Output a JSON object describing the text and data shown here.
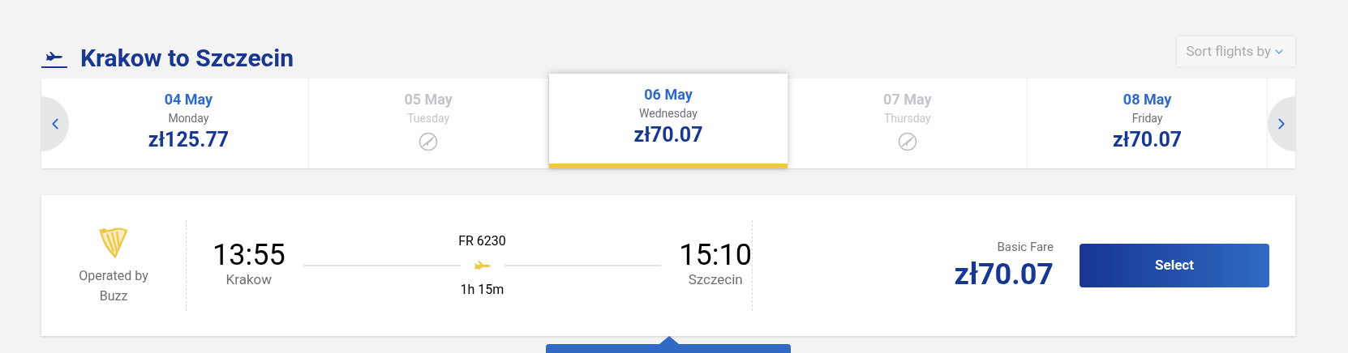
{
  "header": {
    "title": "Krakow to Szczecin",
    "sort_button": "Sort flights by"
  },
  "days": [
    {
      "date": "04 May",
      "weekday": "Monday",
      "kind": "price",
      "price": "zł125.77",
      "selected": false
    },
    {
      "date": "05 May",
      "weekday": "Tuesday",
      "kind": "no-flight",
      "selected": false
    },
    {
      "date": "06 May",
      "weekday": "Wednesday",
      "kind": "price",
      "price": "zł70.07",
      "selected": true
    },
    {
      "date": "07 May",
      "weekday": "Thursday",
      "kind": "no-flight",
      "selected": false
    },
    {
      "date": "08 May",
      "weekday": "Friday",
      "kind": "price",
      "price": "zł70.07",
      "selected": false
    }
  ],
  "flight": {
    "operator_label": "Operated by",
    "operator": "Buzz",
    "departure_time": "13:55",
    "departure_city": "Krakow",
    "flight_number": "FR 6230",
    "duration": "1h 15m",
    "arrival_time": "15:10",
    "arrival_city": "Szczecin",
    "fare_label": "Basic Fare",
    "price": "zł70.07",
    "select_button": "Select"
  }
}
